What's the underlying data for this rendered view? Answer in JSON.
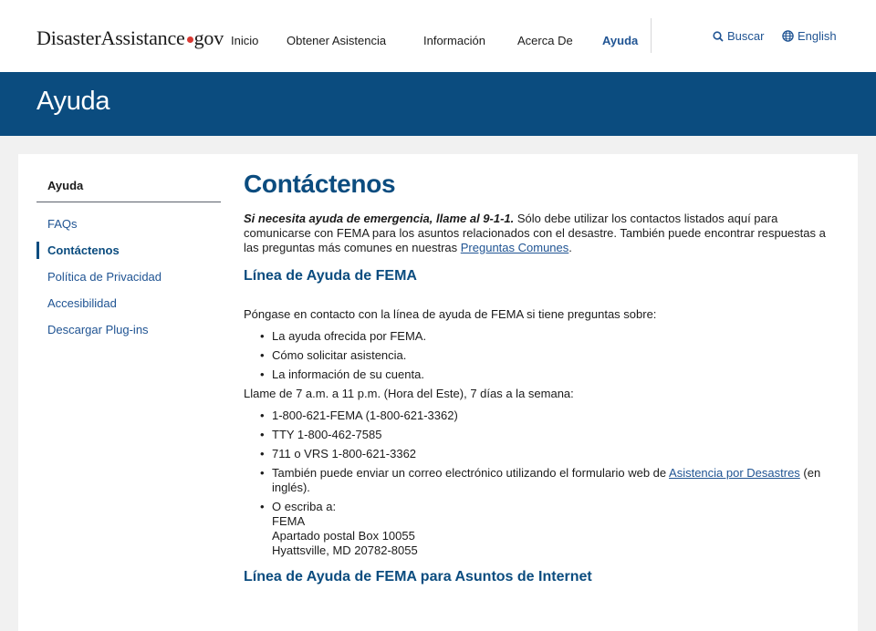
{
  "header": {
    "logo_part1": "Disaster",
    "logo_part2": "Assistance",
    "logo_part3": "gov",
    "nav": [
      "Inicio",
      "Obtener Asistencia",
      "Información",
      "Acerca De",
      "Ayuda"
    ],
    "search_label": "Buscar",
    "language_label": "English"
  },
  "banner": {
    "title": "Ayuda"
  },
  "sidebar": {
    "title": "Ayuda",
    "items": [
      "FAQs",
      "Contáctenos",
      "Política de Privacidad",
      "Accesibilidad",
      "Descargar Plug-ins"
    ]
  },
  "main": {
    "title": "Contáctenos",
    "intro_emphasis": "Si necesita ayuda de emergencia, llame al 9-1-1.",
    "intro_text": " Sólo debe utilizar los contactos listados aquí para comunicarse con FEMA para los asuntos relacionados con el desastre. También puede encontrar respuestas a las preguntas más comunes en nuestras ",
    "intro_link": "Preguntas Comunes",
    "intro_end": ".",
    "section1_title": "Línea de Ayuda de FEMA",
    "section1_intro": "Póngase en contacto con la línea de ayuda de FEMA si tiene preguntas sobre:",
    "topics": [
      "La ayuda ofrecida por FEMA.",
      "Cómo solicitar asistencia.",
      "La información de su cuenta."
    ],
    "hours": "Llame de 7 a.m. a 11 p.m. (Hora del Este), 7 días a la semana:",
    "phones": [
      "1-800-621-FEMA (1-800-621-3362)",
      "TTY 1-800-462-7585",
      "711 o VRS 1-800-621-3362"
    ],
    "email_text": "También puede enviar un correo electrónico utilizando el formulario web de ",
    "email_link": "Asistencia por Desastres",
    "email_end": " (en inglés).",
    "mail_lines": [
      "O escriba a:",
      "FEMA",
      "Apartado postal Box 10055",
      "Hyattsville, MD 20782-8055"
    ],
    "section2_title": "Línea de Ayuda de FEMA para Asuntos de Internet"
  }
}
